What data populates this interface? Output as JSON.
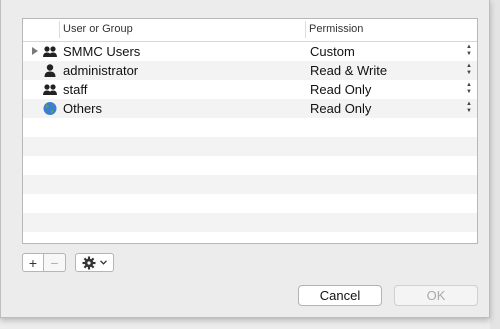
{
  "table": {
    "headers": {
      "user": "User or Group",
      "permission": "Permission"
    },
    "rows": [
      {
        "name": "SMMC Users",
        "permission": "Custom",
        "icon": "group-icon",
        "expandable": true
      },
      {
        "name": "administrator",
        "permission": "Read & Write",
        "icon": "user-icon",
        "expandable": false
      },
      {
        "name": "staff",
        "permission": "Read Only",
        "icon": "group-icon",
        "expandable": false
      },
      {
        "name": "Others",
        "permission": "Read Only",
        "icon": "globe-icon",
        "expandable": false
      }
    ],
    "empty_rows": 7
  },
  "toolbar": {
    "add_label": "+",
    "remove_label": "−",
    "gear_icon": "gear-icon"
  },
  "buttons": {
    "cancel": "Cancel",
    "ok": "OK"
  }
}
